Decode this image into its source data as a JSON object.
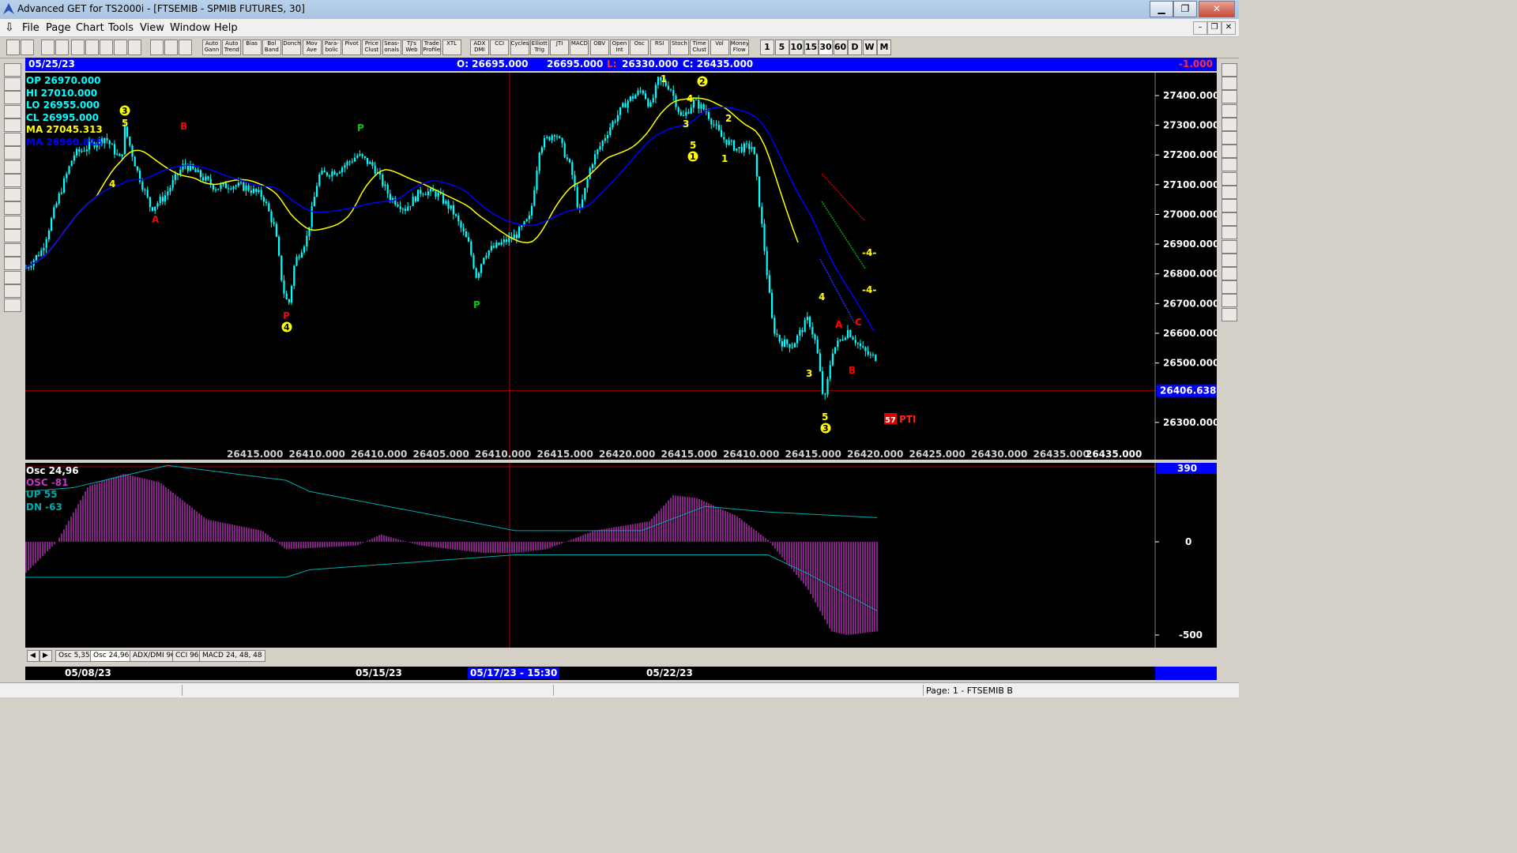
{
  "window": {
    "title": "Advanced GET for TS2000i - [FTSEMIB - SPMIB FUTURES, 30]",
    "min": "▁",
    "max": "❐",
    "close": "✕"
  },
  "menu": [
    "File",
    "Page",
    "Chart",
    "Tools",
    "View",
    "Window",
    "Help"
  ],
  "toolbar": {
    "study_buttons": [
      "Auto Gann",
      "Auto Trend",
      "Bias",
      "Bol Band",
      "Donch",
      "Mov Ave",
      "Para-bolic",
      "Pivot",
      "Price Clust",
      "Seas-onals",
      "TJ's Web",
      "Trade Profile",
      "XTL",
      "ADX DMI",
      "CCI",
      "Cycles",
      "Elliott Trig",
      "JTI",
      "MACD",
      "OBV",
      "Open Int",
      "Osc",
      "RSI",
      "Stoch",
      "Time Clust",
      "Vol",
      "Money Flow"
    ],
    "periods": [
      "1",
      "5",
      "10",
      "15",
      "30",
      "60",
      "D",
      "W",
      "M"
    ],
    "active_period": "30"
  },
  "left_tools": [
    "open-folder",
    "Elliott",
    "RESET",
    "STUDY",
    "Elliott",
    "up",
    "down",
    "left",
    "right",
    "scale",
    "compress",
    "expand",
    "grid",
    "LINES",
    "GANN",
    "FIB",
    "crosshair",
    "print"
  ],
  "right_tools": [
    "X",
    "pen",
    "FIB RET",
    "FIB EXT",
    "FIB TIME",
    "cycle",
    "lines",
    "grid",
    "ellipse",
    "channel",
    "PTI",
    "grid2",
    "MOB",
    "A",
    "zoom",
    "paint",
    "sheet",
    "sheet2",
    "U"
  ],
  "infobar": {
    "date": "05/25/23",
    "ohlc_text": "O: 26695.000",
    "h_text": "26695.000",
    "l_label": "L:",
    "l_value": "26330.000",
    "c_text": "C: 26435.000",
    "right_value": "-1.000"
  },
  "legend": {
    "op": "OP  26970.000",
    "hi": "HI   27010.000",
    "lo": "LO  26955.000",
    "cl": "CL  26995.000",
    "ma1": "MA  27045.313",
    "ma2": "MA  26960.825"
  },
  "colors": {
    "candles": "#00ffff",
    "ma_yellow": "#ffff00",
    "ma_blue": "#0000ff",
    "osc": "#cc33cc",
    "labels_yellow": "#ffff00",
    "labels_red": "#ff0000",
    "labels_green": "#00cc00"
  },
  "price_axis": {
    "ticks": [
      "27400.000",
      "27300.000",
      "27200.000",
      "27100.000",
      "27000.000",
      "26900.000",
      "26800.000",
      "26700.000",
      "26600.000",
      "26500.000",
      "26300.000"
    ],
    "current": "26406.638"
  },
  "projection_row": [
    "26415.000",
    "26410.000",
    "26410.000",
    "26405.000",
    "26410.000",
    "26415.000",
    "26420.000",
    "26415.000",
    "26410.000",
    "26415.000",
    "26420.000",
    "26425.000",
    "26430.000",
    "26435.000",
    "26435.000"
  ],
  "wave_labels": [
    {
      "t": "3",
      "kind": "circle"
    },
    {
      "t": "5",
      "kind": "text"
    },
    {
      "t": "B",
      "kind": "red"
    },
    {
      "t": "4",
      "kind": "text"
    },
    {
      "t": "A",
      "kind": "red"
    },
    {
      "t": "P",
      "kind": "green"
    },
    {
      "t": "P",
      "kind": "red"
    },
    {
      "t": "4",
      "kind": "circle"
    },
    {
      "t": "P",
      "kind": "green"
    },
    {
      "t": "1",
      "kind": "text"
    },
    {
      "t": "2",
      "kind": "circle"
    },
    {
      "t": "4",
      "kind": "text"
    },
    {
      "t": "3",
      "kind": "text"
    },
    {
      "t": "5",
      "kind": "text"
    },
    {
      "t": "1",
      "kind": "circle"
    },
    {
      "t": "2",
      "kind": "text"
    },
    {
      "t": "1",
      "kind": "text"
    },
    {
      "t": "-4-",
      "kind": "text"
    },
    {
      "t": "-4-",
      "kind": "text"
    },
    {
      "t": "4",
      "kind": "text"
    },
    {
      "t": "A",
      "kind": "red"
    },
    {
      "t": "C",
      "kind": "red"
    },
    {
      "t": "3",
      "kind": "text"
    },
    {
      "t": "B",
      "kind": "red"
    },
    {
      "t": "5",
      "kind": "text"
    },
    {
      "t": "3",
      "kind": "circle"
    }
  ],
  "pti": {
    "value": "57",
    "label": "PTI"
  },
  "oscillator": {
    "title": "Osc 24,96",
    "osc": "OSC -81",
    "up": "UP   55",
    "dn": "DN   -63",
    "axis": [
      "390",
      "0",
      "-500"
    ]
  },
  "pane_tabs": [
    "Osc 5,35",
    "Osc 24,96",
    "ADX/DMI 96",
    "CCI 96",
    "MACD 24, 48, 48"
  ],
  "active_pane_tab": "Osc 24,96",
  "dates": [
    "05/08/23",
    "05/15/23",
    "05/17/23 - 15:30",
    "05/22/23"
  ],
  "status": "Page: 1 - FTSEMIB B"
}
